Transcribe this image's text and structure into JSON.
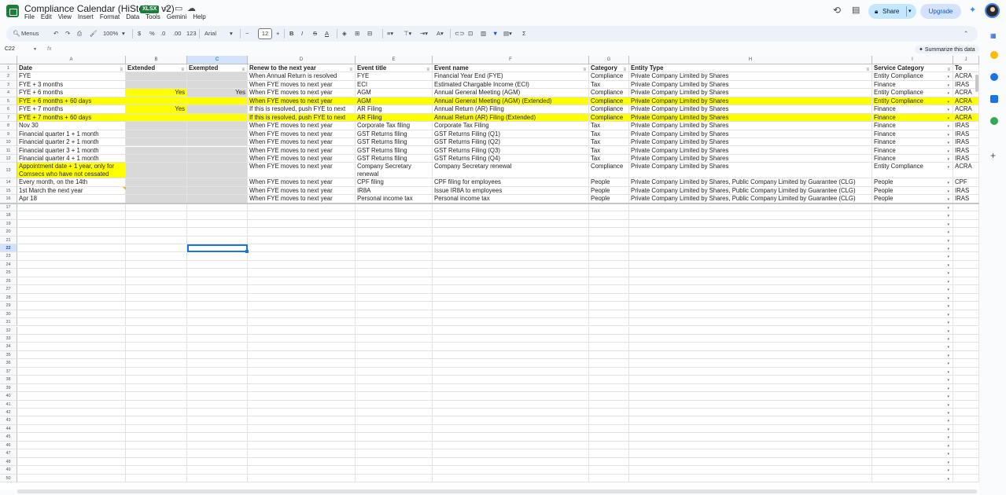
{
  "app": {
    "title": "Compliance Calendar (HiStellar, v2)",
    "file_badge": "XLSX",
    "menus": [
      "File",
      "Edit",
      "View",
      "Insert",
      "Format",
      "Data",
      "Tools",
      "Gemini",
      "Help"
    ],
    "share_label": "Share",
    "upgrade_label": "Upgrade"
  },
  "toolbar": {
    "menus_label": "Menus",
    "zoom": "100%",
    "currency": "$",
    "percent": "%",
    "dec_less": ".0",
    "dec_more": ".00",
    "format_123": "123",
    "font": "Arial",
    "font_size": "12"
  },
  "formula_bar": {
    "name_box": "C22",
    "fx": "fx",
    "formula": "",
    "summarize_label": "Summarize this data"
  },
  "sheet": {
    "columns": [
      "A",
      "B",
      "C",
      "D",
      "E",
      "F",
      "G",
      "H",
      "I",
      "J"
    ],
    "headers": [
      "Date",
      "Extended",
      "Exempted",
      "Renew to the next year",
      "Event title",
      "Event name",
      "Category",
      "Entity Type",
      "Service Category",
      "To"
    ],
    "rows": [
      {
        "num": "2",
        "cells": [
          "FYE",
          "",
          "",
          "When Annual Return is resolved",
          "FYE",
          "Financial Year End (FYE)",
          "Compliance",
          "Private Company Limited by Shares",
          "Entity Compliance",
          "ACRA"
        ]
      },
      {
        "num": "3",
        "cells": [
          "FYE + 3 months",
          "",
          "",
          "When FYE moves to next year",
          "ECI",
          "Estimated Chargable Income (ECI)",
          "Tax",
          "Private Company Limited by Shares",
          "Finance",
          "IRAS"
        ]
      },
      {
        "num": "4",
        "cells": [
          "FYE + 6 months",
          "Yes",
          "Yes",
          "When FYE moves to next year",
          "AGM",
          "Annual General Meeting (AGM)",
          "Compliance",
          "Private Company Limited by Shares",
          "Entity Compliance",
          "ACRA"
        ]
      },
      {
        "num": "5",
        "cells": [
          "FYE + 6 months + 60 days",
          "",
          "",
          "When FYE moves to next year",
          "AGM",
          "Annual General Meeting (AGM) (Extended)",
          "Compliance",
          "Private Company Limited by Shares",
          "Entity Compliance",
          "ACRA"
        ]
      },
      {
        "num": "6",
        "cells": [
          "FYE + 7 months",
          "Yes",
          "",
          "If this is resolved, push FYE to next",
          "AR Filing",
          "Annual Return (AR) Filing",
          "Compliance",
          "Private Company Limited by Shares",
          "Finance",
          "ACRA"
        ]
      },
      {
        "num": "7",
        "cells": [
          "FYE + 7 months + 60 days",
          "",
          "",
          "If this is resolved, push FYE to next",
          "AR Filing",
          "Annual Return (AR) Filing (Extended)",
          "Compliance",
          "Private Company Limited by Shares",
          "Finance",
          "ACRA"
        ]
      },
      {
        "num": "8",
        "cells": [
          "Nov 30",
          "",
          "",
          "When FYE moves to next year",
          "Corporate Tax filing",
          "Corporate Tax Filing",
          "Tax",
          "Private Company Limited by Shares",
          "Finance",
          "IRAS"
        ]
      },
      {
        "num": "9",
        "cells": [
          "Financial quarter 1 + 1 month",
          "",
          "",
          "When FYE moves to next year",
          "GST Returns filing",
          "GST Returns Filing (Q1)",
          "Tax",
          "Private Company Limited by Shares",
          "Finance",
          "IRAS"
        ]
      },
      {
        "num": "10",
        "cells": [
          "Financial quarter 2 + 1 month",
          "",
          "",
          "When FYE moves to next year",
          "GST Returns filing",
          "GST Returns Filing (Q2)",
          "Tax",
          "Private Company Limited by Shares",
          "Finance",
          "IRAS"
        ]
      },
      {
        "num": "11",
        "cells": [
          "Financial quarter 3 + 1 month",
          "",
          "",
          "When FYE moves to next year",
          "GST Returns filing",
          "GST Returns Filing (Q3)",
          "Tax",
          "Private Company Limited by Shares",
          "Finance",
          "IRAS"
        ]
      },
      {
        "num": "12",
        "cells": [
          "Financial quarter 4 + 1 month",
          "",
          "",
          "When FYE moves to next year",
          "GST Returns filing",
          "GST Returns Filing (Q4)",
          "Tax",
          "Private Company Limited by Shares",
          "Finance",
          "IRAS"
        ]
      },
      {
        "num": "13",
        "cells": [
          "Appointment date + 1 year, only for Comsecs who have not cessated",
          "",
          "",
          "When FYE moves to next year",
          "Company Secretary renewal",
          "Company Secretary renewal",
          "Compliance",
          "Private Company Limited by Shares",
          "Entity Compliance",
          "ACRA"
        ]
      },
      {
        "num": "14",
        "cells": [
          "Every month, on the 14th",
          "",
          "",
          "When FYE moves to next year",
          "CPF filing",
          "CPF filing for employees",
          "People",
          "Private Company Limited by Shares, Public Company Limited by Guarantee (CLG)",
          "People",
          "CPF"
        ]
      },
      {
        "num": "15",
        "cells": [
          "1st March the next year",
          "",
          "",
          "When FYE moves to next year",
          "IR8A",
          "Issue IR8A to employees",
          "People",
          "Private Company Limited by Shares, Public Company Limited by Guarantee (CLG)",
          "People",
          "IRAS"
        ]
      },
      {
        "num": "16",
        "cells": [
          "Apr 18",
          "",
          "",
          "When FYE moves to next year",
          "Personal income tax",
          "Personal income tax",
          "People",
          "Private Company Limited by Shares, Public Company Limited by Guarantee (CLG)",
          "People",
          "IRAS"
        ]
      }
    ],
    "empty_rows_start": 17,
    "empty_rows_end": 50,
    "highlight_color": "#ffff00",
    "grey_color": "#d9d9d9"
  }
}
